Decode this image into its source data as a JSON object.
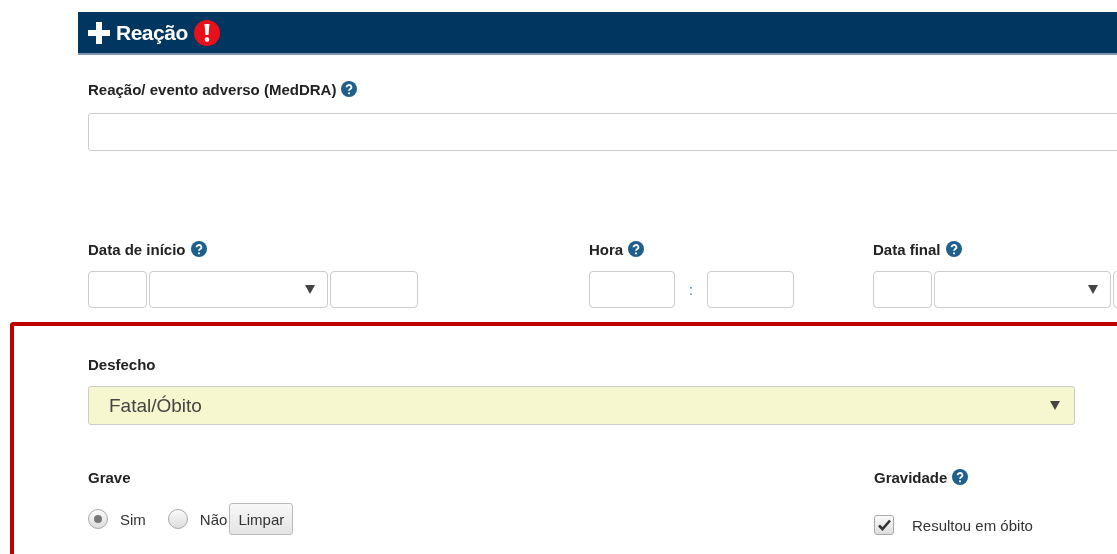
{
  "section": {
    "title": "Reação"
  },
  "reaction": {
    "label": "Reação/ evento adverso (MedDRA)"
  },
  "start_date": {
    "label": "Data de início"
  },
  "time": {
    "label": "Hora",
    "separator": ":"
  },
  "end_date": {
    "label": "Data final"
  },
  "outcome": {
    "label": "Desfecho",
    "value": "Fatal/Óbito"
  },
  "serious": {
    "label": "Grave",
    "options": [
      {
        "label": "Sim",
        "selected": true
      },
      {
        "label": "Não",
        "selected": false
      }
    ],
    "clear_button": "Limpar"
  },
  "severity": {
    "label": "Gravidade",
    "options": [
      {
        "label": "Resultou em óbito",
        "checked": true
      }
    ]
  }
}
